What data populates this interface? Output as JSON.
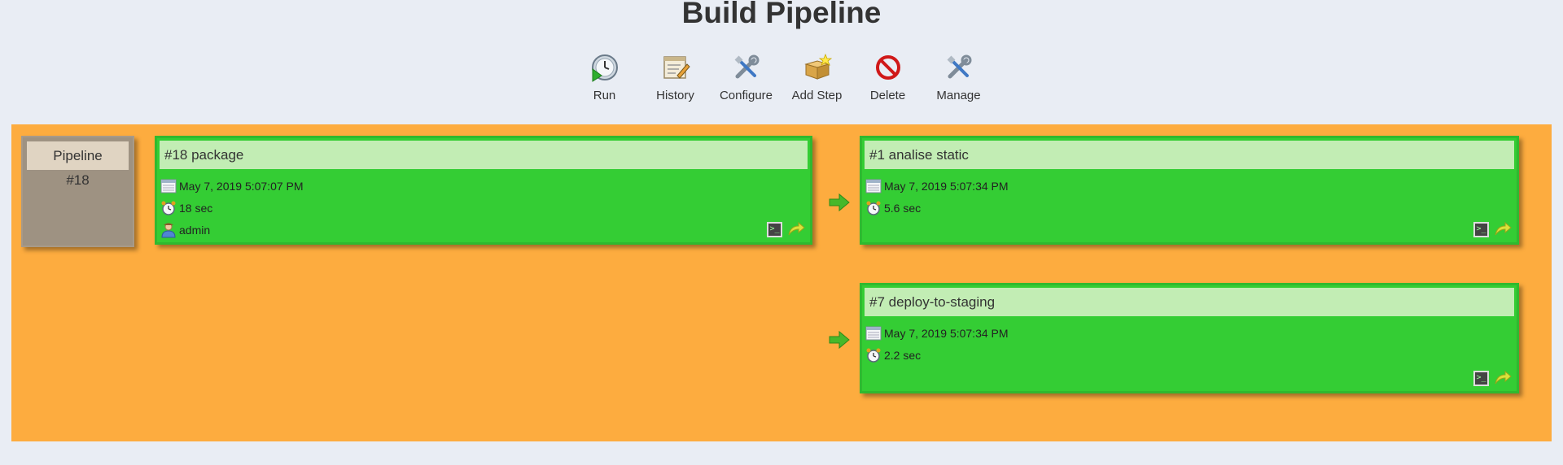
{
  "title": "Build Pipeline",
  "toolbar": {
    "items": [
      {
        "label": "Run",
        "icon": "run-icon"
      },
      {
        "label": "History",
        "icon": "history-icon"
      },
      {
        "label": "Configure",
        "icon": "configure-icon"
      },
      {
        "label": "Add Step",
        "icon": "add-step-icon"
      },
      {
        "label": "Delete",
        "icon": "delete-icon"
      },
      {
        "label": "Manage",
        "icon": "manage-icon"
      }
    ]
  },
  "colors": {
    "background": "#e9edf4",
    "board": "#fdac3f",
    "success": "#34cd34",
    "success_header": "#c2edb4",
    "pipeline_box": "#9e9282"
  },
  "pipeline": {
    "label": "Pipeline",
    "number": "#18"
  },
  "builds": [
    {
      "title": "#18 package",
      "date": "May 7, 2019 5:07:07 PM",
      "duration": "18 sec",
      "user": "admin",
      "status": "success"
    },
    {
      "title": "#1 analise static",
      "date": "May 7, 2019 5:07:34 PM",
      "duration": "5.6 sec",
      "status": "success"
    },
    {
      "title": "#7 deploy-to-staging",
      "date": "May 7, 2019 5:07:34 PM",
      "duration": "2.2 sec",
      "status": "success"
    }
  ]
}
